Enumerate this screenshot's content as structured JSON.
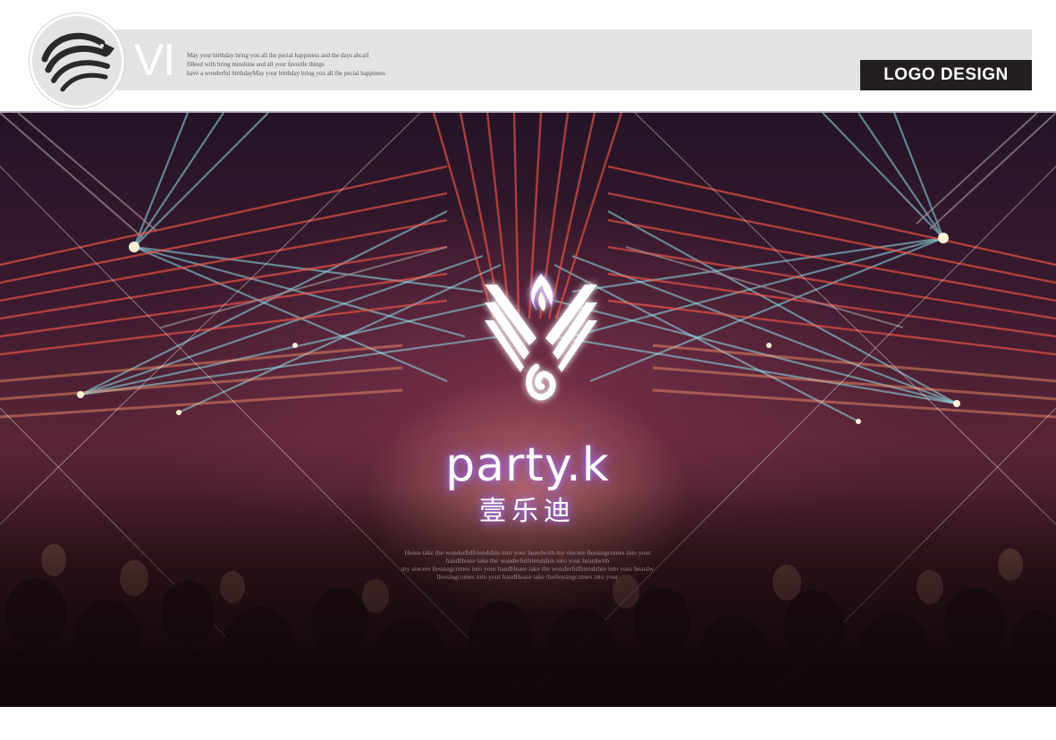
{
  "header": {
    "vi_mark": "VI",
    "text_lines": [
      "May your birthday bring you all the pecial happiness and  the days ahcail",
      "filleed with bring  minshine and all your favorile things",
      "have a wonderful birthdayMay your birthday bring you all the pecial happiness"
    ],
    "tag_label": "LOGO DESIGN"
  },
  "brand": {
    "name": "party.k",
    "chinese_name": "壹乐迪",
    "blessing_lines": [
      "Hease take the wonderfulfriendshin into your heardwith my sincere llessingcomes into your",
      "handHease take the wonderfulfriendshin into your heardwith",
      "my sincere llessingcomes into your handHease take the wonderfulfriendshin into your heardw",
      "llessingcomes into your handHease take thellessingcomes into your"
    ]
  },
  "colors": {
    "header_band": "#e3e3e4",
    "tag_background": "#231f20",
    "glow": "#a878ff"
  },
  "icons": {
    "header_badge": "eagle-head-icon",
    "brand_emblem": "flame-wings-emblem-icon"
  }
}
